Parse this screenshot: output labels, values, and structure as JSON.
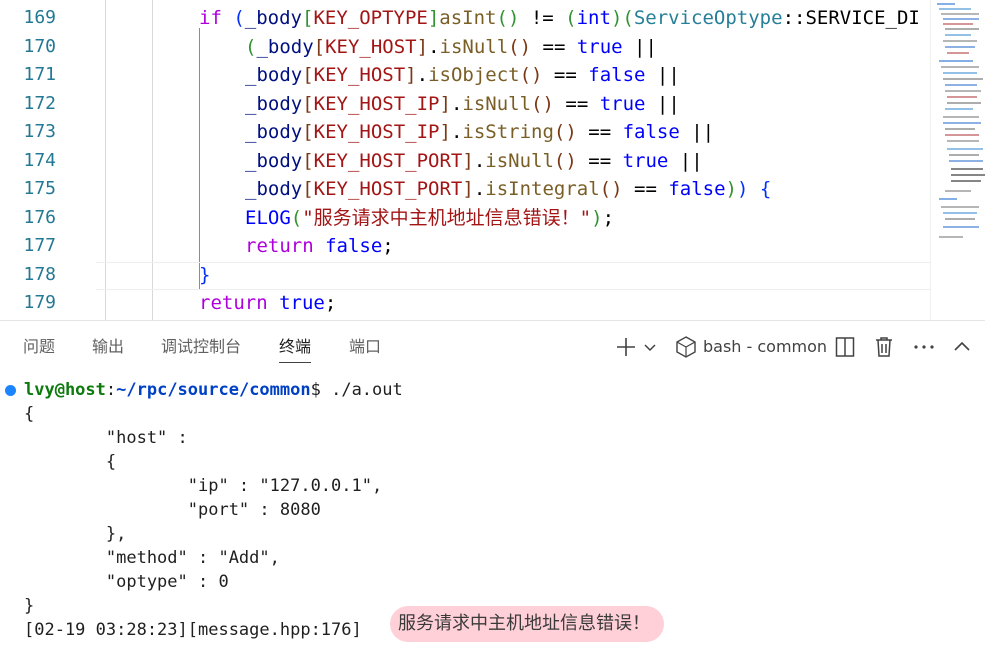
{
  "editor": {
    "line_numbers": [
      "169",
      "170",
      "171",
      "172",
      "173",
      "174",
      "175",
      "176",
      "177",
      "178",
      "179"
    ],
    "lines": {
      "l169": {
        "if": "if",
        "sp1": " ",
        "p1": "(",
        "body": "_body",
        "lb": "[",
        "key": "KEY_OPTYPE",
        "rb": "]",
        ".": ".",
        "fn": "asInt",
        "call": "()",
        "ne": " != ",
        "p2": "(",
        "int": "int",
        "p3": ")",
        "p4": "(",
        "type": "ServiceOptype",
        "sep": "::",
        "rest": "SERVICE_DI"
      },
      "l170": {
        "p": "(",
        "body": "_body",
        "lb": "[",
        "key": "KEY_HOST",
        "rb": "]",
        "dot": ".",
        "fn": "isNull",
        "call": "()",
        "eq": " == ",
        "val": "true",
        "or": " ||"
      },
      "l171": {
        "body": "_body",
        "lb": "[",
        "key": "KEY_HOST",
        "rb": "]",
        "dot": ".",
        "fn": "isObject",
        "call": "()",
        "eq": " == ",
        "val": "false",
        "or": " ||"
      },
      "l172": {
        "body": "_body",
        "lb": "[",
        "key": "KEY_HOST_IP",
        "rb": "]",
        "dot": ".",
        "fn": "isNull",
        "call": "()",
        "eq": " == ",
        "val": "true",
        "or": " ||"
      },
      "l173": {
        "body": "_body",
        "lb": "[",
        "key": "KEY_HOST_IP",
        "rb": "]",
        "dot": ".",
        "fn": "isString",
        "call": "()",
        "eq": " == ",
        "val": "false",
        "or": " ||"
      },
      "l174": {
        "body": "_body",
        "lb": "[",
        "key": "KEY_HOST_PORT",
        "rb": "]",
        "dot": ".",
        "fn": "isNull",
        "call": "()",
        "eq": " == ",
        "val": "true",
        "or": " ||"
      },
      "l175": {
        "body": "_body",
        "lb": "[",
        "key": "KEY_HOST_PORT",
        "rb": "]",
        "dot": ".",
        "fn": "isIntegral",
        "call": "()",
        "eq": " == ",
        "val": "false",
        "close1": ")",
        "close2": ")",
        "brace": " {"
      },
      "l176": {
        "mac": "ELOG",
        "p1": "(",
        "str": "\"服务请求中主机地址信息错误！\"",
        "p2": ")",
        "semi": ";"
      },
      "l177": {
        "ret": "return",
        "sp": " ",
        "val": "false",
        "semi": ";"
      },
      "l178": {
        "brace": "}"
      },
      "l179": {
        "ret": "return",
        "sp": " ",
        "val": "true",
        "semi": ";"
      }
    }
  },
  "panel": {
    "tabs": [
      "问题",
      "输出",
      "调试控制台",
      "终端",
      "端口"
    ],
    "active_tab": "终端",
    "terminal_name": "bash - common",
    "icons": [
      "plus-icon",
      "chevron-down-icon",
      "terminal-shell-icon",
      "split-icon",
      "trash-icon",
      "more-icon",
      "chevron-up-icon"
    ]
  },
  "terminal": {
    "prompt_user": "lvy@host",
    "prompt_sep": ":",
    "prompt_path": "~/rpc/source/common",
    "prompt_end": "$ ",
    "command": "./a.out",
    "output": [
      "{",
      "        \"host\" :",
      "        {",
      "                \"ip\" : \"127.0.0.1\",",
      "                \"port\" : 8080",
      "        },",
      "        \"method\" : \"Add\",",
      "        \"optype\" : 0",
      "}"
    ],
    "log_prefix": "[02-19 03:28:23][message.hpp:176]",
    "log_message": "服务请求中主机地址信息错误！"
  },
  "colors": {
    "line_number": "#237893",
    "keyword": "#0000ff",
    "macro": "#a31515",
    "function": "#795e26",
    "prompt_user": "#0d7a0d",
    "prompt_path": "#0040c4",
    "error_highlight": "#ffd0d8"
  }
}
